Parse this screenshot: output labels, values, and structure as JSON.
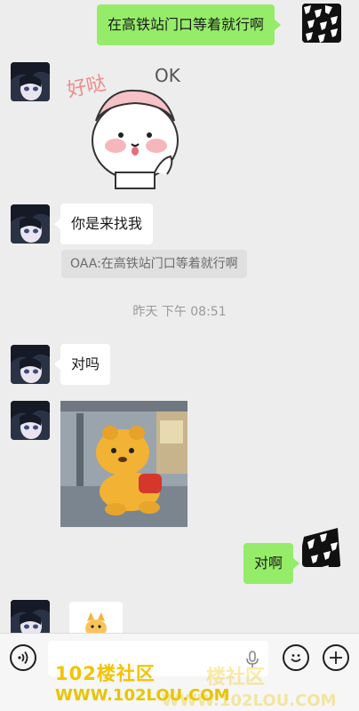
{
  "messages": {
    "m1_text": "在高铁站门口等着就行啊",
    "m2_sticker_text_haoda": "好哒",
    "m2_sticker_text_ok": "OK",
    "m3_text": "你是来找我",
    "m3_quote": "OAA:在高铁站门口等着就行啊",
    "timestamp": "昨天 下午 08:51",
    "m4_text": "对吗",
    "m6_text": "对啊"
  },
  "input_bar": {
    "voice_icon": "voice-wave-icon",
    "mic_icon": "microphone-icon",
    "emoji_icon": "smiley-icon",
    "plus_icon": "plus-icon",
    "value": ""
  },
  "watermark": {
    "line1": "102楼社区",
    "line1_ghost": "楼社区",
    "line2": "WWW.102LOU.COM",
    "line2_ghost": "WWW.102LOU.COM"
  },
  "colors": {
    "background": "#ededed",
    "incoming_bubble": "#ffffff",
    "outgoing_bubble": "#95ec69",
    "quote_bg": "#e0e0e0",
    "watermark": "#f3c300"
  }
}
